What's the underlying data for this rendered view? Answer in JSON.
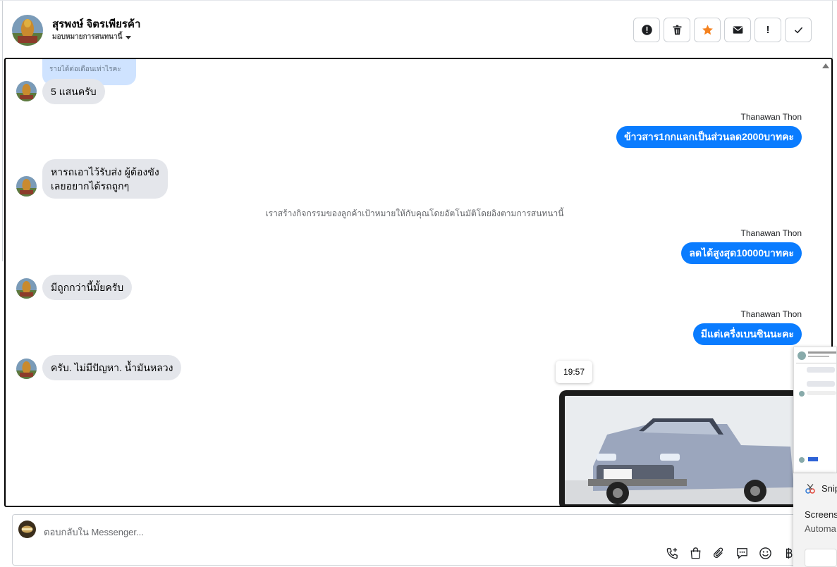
{
  "header": {
    "contact_name": "สุรพงษ์ จิตรเพียรค้า",
    "assign_label": "มอบหมายการสนทนานี้",
    "colors": {
      "star": "#f5821f",
      "border": "#ccd0d5"
    }
  },
  "actions": [
    {
      "icon": "alert-circle-icon",
      "label": ""
    },
    {
      "icon": "trash-icon",
      "label": ""
    },
    {
      "icon": "star-icon",
      "label": ""
    },
    {
      "icon": "envelope-icon",
      "label": ""
    },
    {
      "icon": "exclamation-icon",
      "label": "!"
    },
    {
      "icon": "check-icon",
      "label": ""
    }
  ],
  "messages": {
    "quoted_reply": "รายได้ต่อเดือนเท่าไรคะ",
    "m1": "5 แสนครับ",
    "sender_1": "Thanawan Thon",
    "m2": "ข้าวสาร1กกแลกเป็นส่วนลด2000บาทคะ",
    "m3_line1": "หารถเอาไว้รับส่ง ผู้ต้องขัง",
    "m3_line2": "เลยอยากได้รถถูกๆ",
    "system_note": "เราสร้างกิจกรรมของลูกค้าเป้าหมายให้กับคุณโดยอัตโนมัติโดยอิงตามการสนทนานี้",
    "sender_2": "Thanawan Thon",
    "m4": "ลดได้สูงสุด10000บาทคะ",
    "m5": "มีถูกกว่านี้มั้ยครับ",
    "sender_3": "Thanawan Thon",
    "m6": "มีแต่เครื่งเบนซินนะคะ",
    "m7": "ครับ. ไม่มีปัญหา. น้ำมันหลวง",
    "time_tooltip": "19:57",
    "colors": {
      "outgoing": "#0a7cff",
      "incoming": "#e4e6eb",
      "quoted": "#cfe3ff"
    }
  },
  "composer": {
    "placeholder": "ตอบกลับใน Messenger...",
    "tools": [
      "phone-plus-icon",
      "shopping-bag-icon",
      "paperclip-icon",
      "chat-bubble-icon",
      "emoji-icon",
      "baht-icon"
    ]
  },
  "snip": {
    "title": "Snip",
    "text1": "Screens",
    "text2": "Automa"
  }
}
